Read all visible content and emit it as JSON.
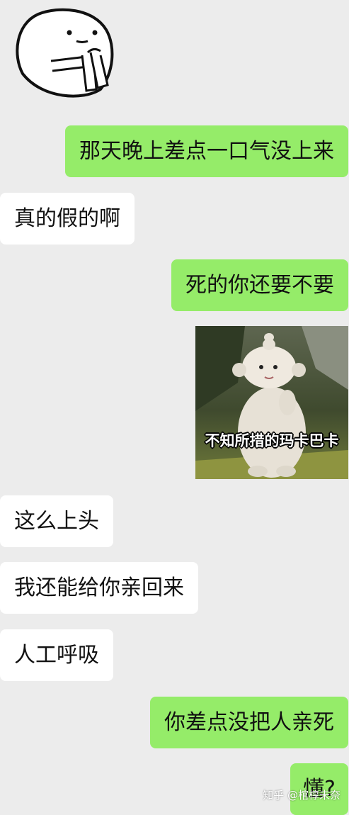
{
  "chat": {
    "sticker_top": {
      "description": "panda-head-sticker"
    },
    "messages": [
      {
        "side": "out",
        "text": "那天晚上差点一口气没上来"
      },
      {
        "side": "in",
        "text": "真的假的啊"
      },
      {
        "side": "out",
        "text": "死的你还要不要"
      },
      {
        "side": "out",
        "type": "image",
        "caption": "不知所措的玛卡巴卡"
      },
      {
        "side": "in",
        "text": "这么上头"
      },
      {
        "side": "in",
        "text": "我还能给你亲回来"
      },
      {
        "side": "in",
        "text": "人工呼吸"
      },
      {
        "side": "out",
        "text": "你差点没把人亲死"
      },
      {
        "side": "out",
        "text": "懂?"
      }
    ]
  },
  "watermark": "知乎 @棺椁未奈",
  "colors": {
    "background": "#ececec",
    "outgoing": "#95ec69",
    "incoming": "#ffffff"
  }
}
